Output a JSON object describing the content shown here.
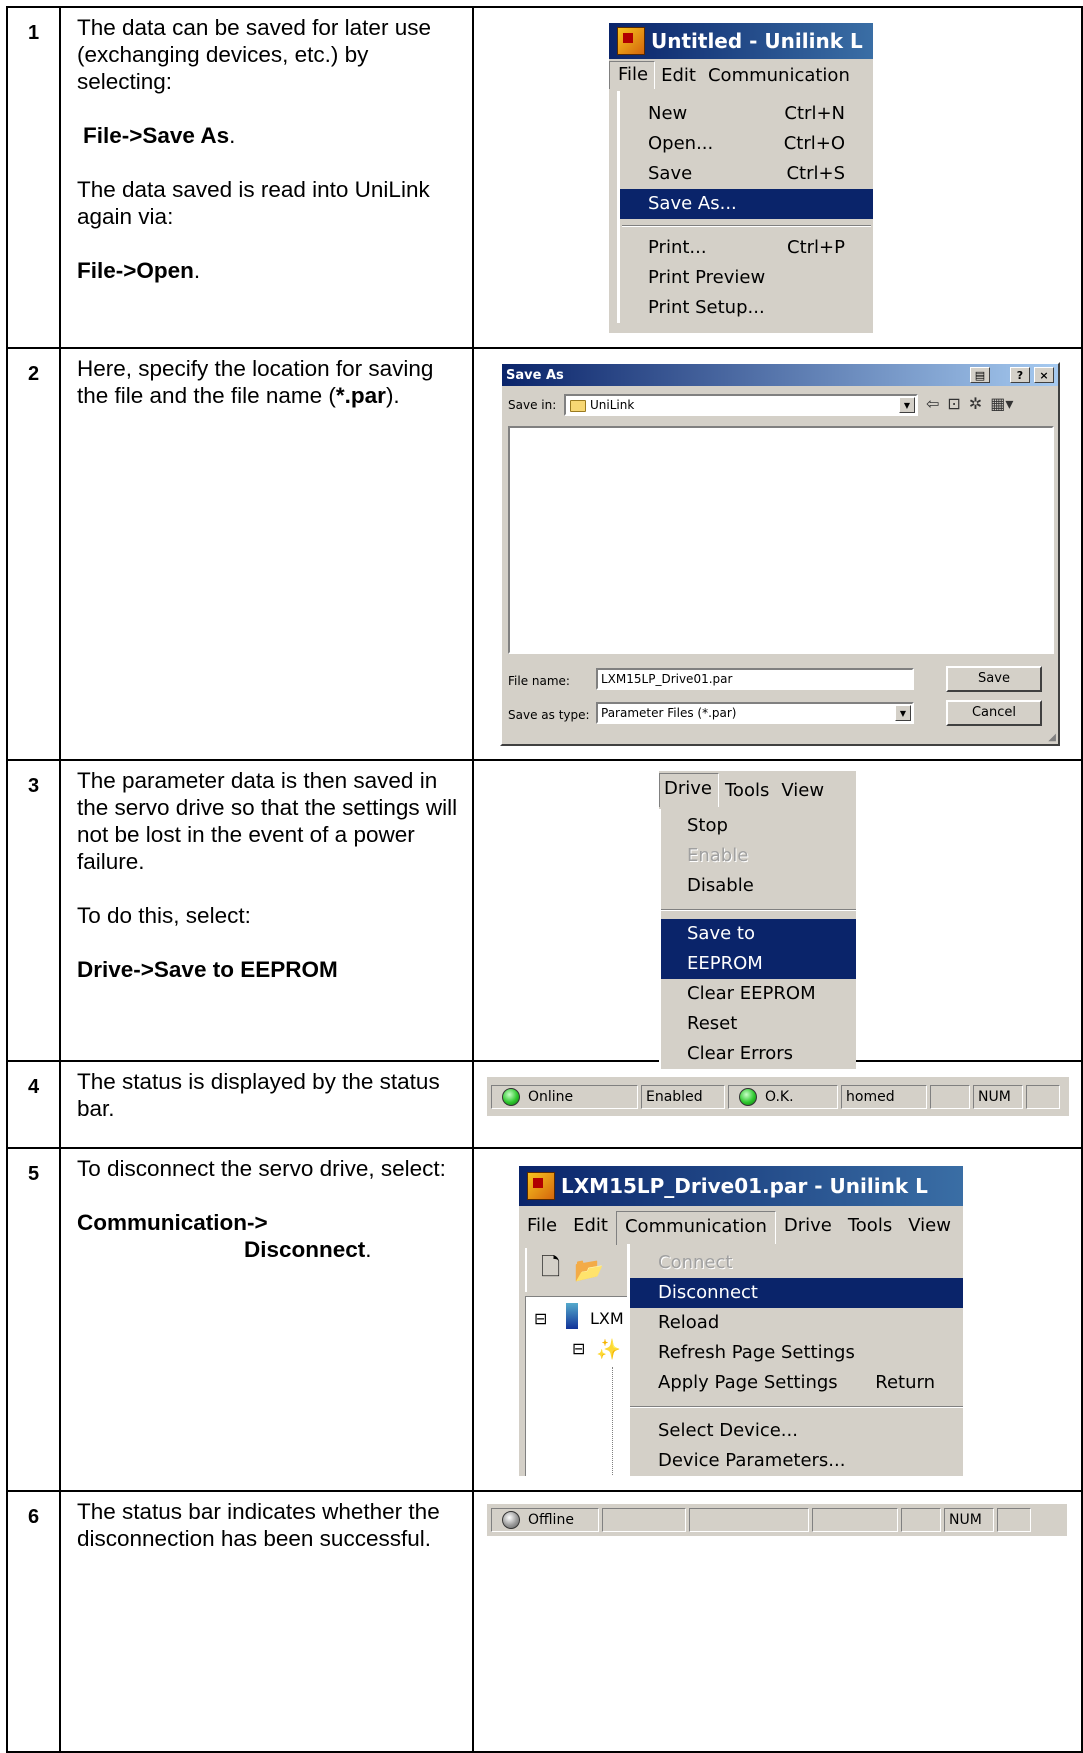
{
  "steps": [
    {
      "num": "1",
      "text": {
        "p1": "The data can be saved for later use (exchanging devices, etc.) by selecting:",
        "p2_bold": "File->Save As",
        "p2_tail": ".",
        "p3": "The data saved is read into UniLink again via:",
        "p4_bold": "File->Open",
        "p4_tail": "."
      },
      "screenshot": {
        "window_title": "Untitled - Unilink L",
        "menubar": [
          "File",
          "Edit",
          "Communication"
        ],
        "menu": [
          {
            "label": "New",
            "shortcut": "Ctrl+N"
          },
          {
            "label": "Open...",
            "shortcut": "Ctrl+O"
          },
          {
            "label": "Save",
            "shortcut": "Ctrl+S"
          },
          {
            "label": "Save As...",
            "shortcut": ""
          },
          {
            "label": "Print...",
            "shortcut": "Ctrl+P"
          },
          {
            "label": "Print Preview",
            "shortcut": ""
          },
          {
            "label": "Print Setup...",
            "shortcut": ""
          }
        ],
        "selected_item": "Save As..."
      }
    },
    {
      "num": "2",
      "text": {
        "p1_pre": "Here, specify the location for saving the file and the file name (",
        "p1_bold": "*.par",
        "p1_tail": ")."
      },
      "screenshot": {
        "dialog_title": "Save As",
        "save_in_label": "Save in:",
        "save_in_value": "UniLink",
        "file_name_label": "File name:",
        "file_name_value": "LXM15LP_Drive01.par",
        "save_type_label": "Save as type:",
        "save_type_value": "Parameter Files (*.par)",
        "save_button": "Save",
        "cancel_button": "Cancel",
        "help_button": "?",
        "close_button": "×",
        "toolbar_icons": [
          "back-arrow-icon",
          "up-folder-icon",
          "new-folder-icon",
          "view-menu-icon"
        ]
      }
    },
    {
      "num": "3",
      "text": {
        "p1": "The parameter data is then saved in the servo drive so that the settings will not be lost in the event of a power failure.",
        "p2": "To do this, select:",
        "p3_bold": "Drive->Save to EEPROM"
      },
      "screenshot": {
        "menubar": [
          "Drive",
          "Tools",
          "View"
        ],
        "menu": [
          {
            "label": "Stop",
            "disabled": false
          },
          {
            "label": "Enable",
            "disabled": true
          },
          {
            "label": "Disable",
            "disabled": false
          },
          {
            "label": "Save to EEPROM",
            "disabled": false
          },
          {
            "label": "Clear EEPROM",
            "disabled": false
          },
          {
            "label": "Reset",
            "disabled": false
          },
          {
            "label": "Clear Errors",
            "disabled": false
          }
        ],
        "selected_item": "Save to EEPROM"
      }
    },
    {
      "num": "4",
      "text": {
        "p1": "The status is displayed by the status bar."
      },
      "screenshot": {
        "cells": [
          "Online",
          "Enabled",
          "O.K.",
          "homed",
          "",
          "NUM",
          ""
        ]
      }
    },
    {
      "num": "5",
      "text": {
        "p1": "To disconnect the servo drive, select:",
        "p2_bold_a": "Communication->",
        "p2_bold_b": "Disconnect",
        "p2_tail": "."
      },
      "screenshot": {
        "window_title": "LXM15LP_Drive01.par - Unilink L",
        "menubar": [
          "File",
          "Edit",
          "Communication",
          "Drive",
          "Tools",
          "View"
        ],
        "menu": [
          {
            "label": "Connect",
            "shortcut": "",
            "disabled": true
          },
          {
            "label": "Disconnect",
            "shortcut": "",
            "disabled": false
          },
          {
            "label": "Reload",
            "shortcut": "",
            "disabled": false
          },
          {
            "label": "Refresh Page Settings",
            "shortcut": "",
            "disabled": false
          },
          {
            "label": "Apply Page Settings",
            "shortcut": "Return",
            "disabled": false
          },
          {
            "label": "Select Device...",
            "shortcut": "",
            "disabled": false
          },
          {
            "label": "Device Parameters...",
            "shortcut": "",
            "disabled": false
          }
        ],
        "tree_label": "LXM",
        "selected_item": "Disconnect"
      }
    },
    {
      "num": "6",
      "text": {
        "p1": "The status bar indicates whether the disconnection has been successful."
      },
      "screenshot": {
        "cells": [
          "Offline",
          "",
          "",
          "",
          "",
          "NUM",
          ""
        ]
      }
    }
  ]
}
